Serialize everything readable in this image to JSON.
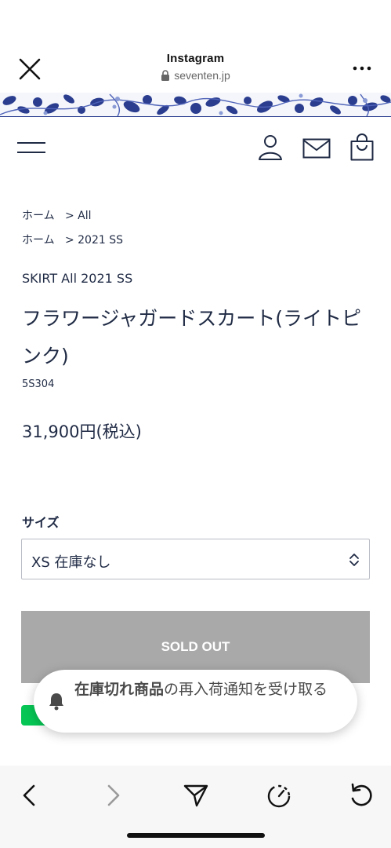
{
  "browser": {
    "title": "Instagram",
    "url": "seventen.jp",
    "close_icon": "close-icon",
    "more_icon": "more-icon",
    "lock_icon": "lock-icon"
  },
  "site_header": {
    "menu_icon": "hamburger-menu-icon",
    "account_icon": "user-icon",
    "contact_icon": "mail-icon",
    "cart_icon": "shopping-bag-icon"
  },
  "breadcrumbs": [
    {
      "home": "ホーム",
      "separator": ">",
      "target": "All"
    },
    {
      "home": "ホーム",
      "separator": ">",
      "target": "2021 SS"
    }
  ],
  "product": {
    "category_line": "SKIRT All 2021 SS",
    "title": "フラワージャガードスカート(ライトピンク)",
    "sku": "5S304",
    "price": "31,900円(税込)"
  },
  "size": {
    "label": "サイズ",
    "selected": "XS  在庫なし"
  },
  "purchase": {
    "sold_out_label": "SOLD OUT"
  },
  "notify": {
    "bold_text": "在庫切れ商品",
    "text": "の再入荷通知を受け取る",
    "icon": "bell-icon"
  },
  "toolbar": {
    "back_icon": "chevron-left-icon",
    "forward_icon": "chevron-right-icon",
    "share_icon": "send-icon",
    "timer_icon": "timer-icon",
    "reload_icon": "reload-icon"
  },
  "colors": {
    "text": "#1f2a44",
    "sold_out_bg": "#a9a9a9",
    "banner_blue": "#2b3d8f",
    "line_green": "#06c755"
  }
}
